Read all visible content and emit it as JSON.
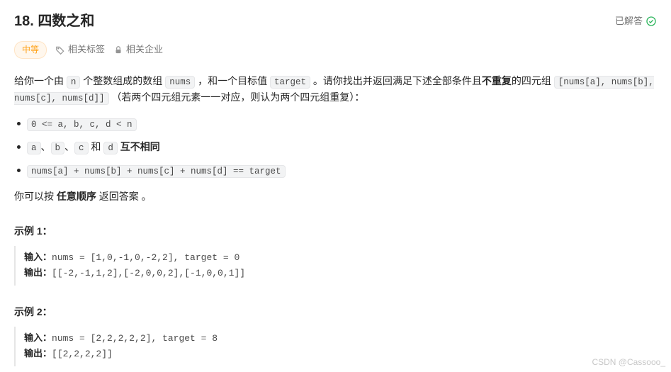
{
  "header": {
    "title": "18. 四数之和",
    "solved_label": "已解答"
  },
  "meta": {
    "difficulty": "中等",
    "tags_label": "相关标签",
    "companies_label": "相关企业"
  },
  "description": {
    "p1_a": "给你一个由 ",
    "p1_n": "n",
    "p1_b": " 个整数组成的数组 ",
    "p1_nums": "nums",
    "p1_c": " ，和一个目标值 ",
    "p1_target": "target",
    "p1_d": " 。请你找出并返回满足下述全部条件且",
    "p1_bold": "不重复",
    "p1_e": "的四元组 ",
    "p1_tuple": "[nums[a], nums[b], nums[c], nums[d]]",
    "p1_f": " （若两个四元组元素一一对应，则认为两个四元组重复）：",
    "li1": "0 <= a, b, c, d < n",
    "li2_a": "a",
    "li2_s1": "、",
    "li2_b": "b",
    "li2_s2": "、",
    "li2_c": "c",
    "li2_and": " 和 ",
    "li2_d": "d",
    "li2_tail": " 互不相同",
    "li3": "nums[a] + nums[b] + nums[c] + nums[d] == target",
    "p2_a": "你可以按 ",
    "p2_bold": "任意顺序",
    "p2_b": " 返回答案 。"
  },
  "examples": {
    "ex1_title": "示例 1：",
    "ex2_title": "示例 2：",
    "input_label": "输入：",
    "output_label": "输出：",
    "ex1_input": "nums = [1,0,-1,0,-2,2], target = 0",
    "ex1_output": "[[-2,-1,1,2],[-2,0,0,2],[-1,0,0,1]]",
    "ex2_input": "nums = [2,2,2,2,2], target = 8",
    "ex2_output": "[[2,2,2,2]]"
  },
  "watermark": "CSDN @Cassooo_"
}
